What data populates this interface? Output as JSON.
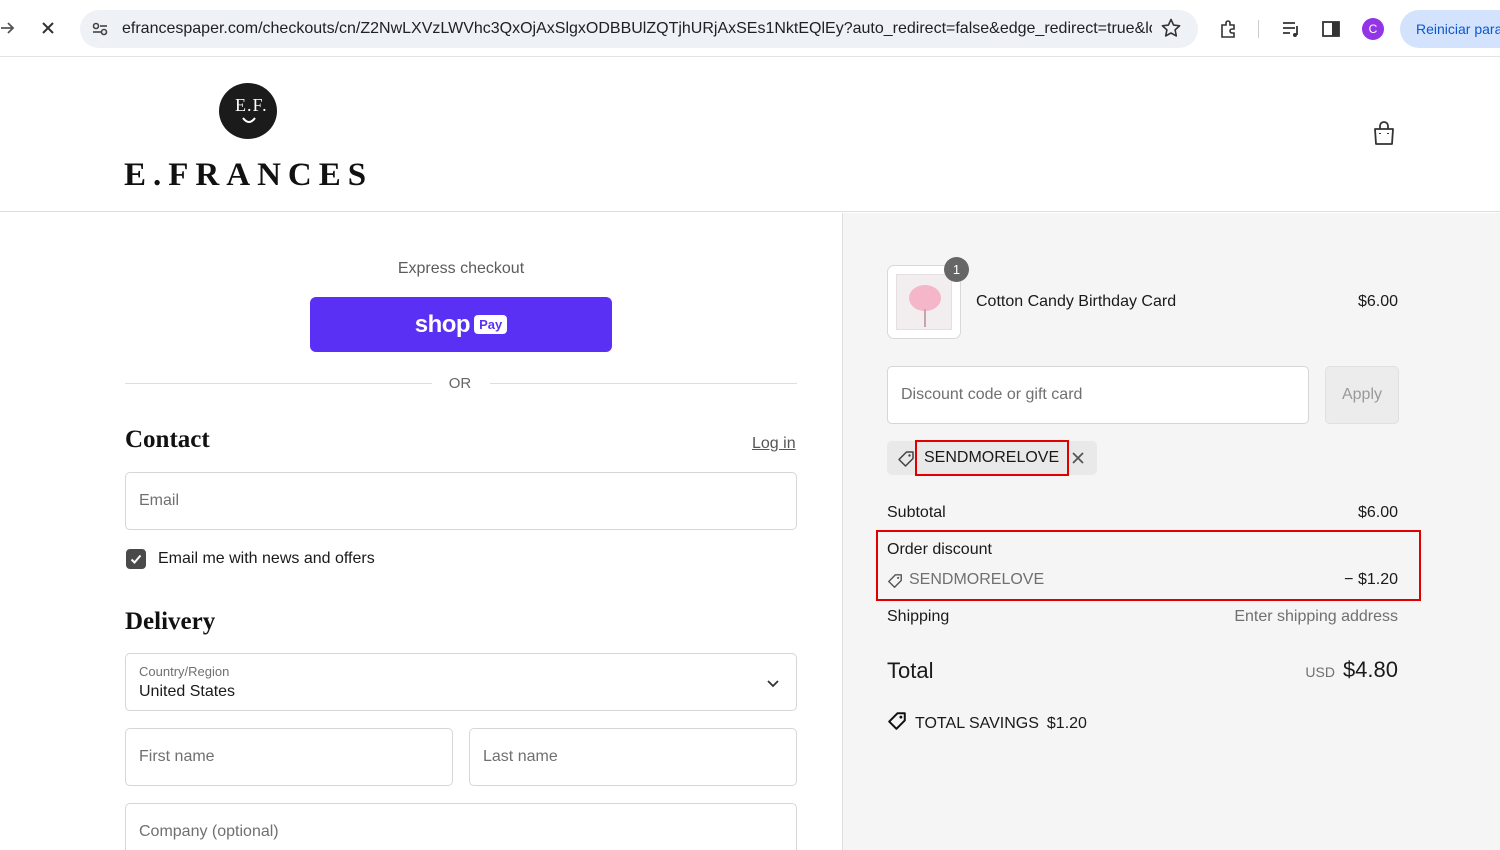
{
  "browser": {
    "url": "efrancespaper.com/checkouts/cn/Z2NwLXVzLWVhc3QxOjAxSlgxODBBUlZQTjhURjAxSEs1NktEQlEy?auto_redirect=false&edge_redirect=true&lo...",
    "profile_initial": "C",
    "reiniciar_label": "Reiniciar para"
  },
  "header": {
    "logo_initials": "E.F.",
    "brand": "E.FRANCES"
  },
  "checkout": {
    "express_label": "Express checkout",
    "shop_pay": {
      "shop": "shop",
      "pay": "Pay"
    },
    "or_label": "OR",
    "contact": {
      "title": "Contact",
      "login_label": "Log in",
      "email_placeholder": "Email",
      "news_checkbox_label": "Email me with news and offers",
      "news_checked": true
    },
    "delivery": {
      "title": "Delivery",
      "country_label": "Country/Region",
      "country_value": "United States",
      "first_name_placeholder": "First name",
      "last_name_placeholder": "Last name",
      "company_placeholder": "Company (optional)"
    }
  },
  "summary": {
    "item": {
      "quantity": "1",
      "name": "Cotton Candy Birthday Card",
      "price": "$6.00"
    },
    "discount_placeholder": "Discount code or gift card",
    "apply_label": "Apply",
    "applied_code": "SENDMORELOVE",
    "subtotal_label": "Subtotal",
    "subtotal_value": "$6.00",
    "order_discount_label": "Order discount",
    "order_discount_code": "SENDMORELOVE",
    "order_discount_value": "− $1.20",
    "shipping_label": "Shipping",
    "shipping_value": "Enter shipping address",
    "total_label": "Total",
    "total_currency": "USD",
    "total_value": "$4.80",
    "savings_label": "TOTAL SAVINGS",
    "savings_value": "$1.20"
  },
  "colors": {
    "shop_pay": "#5a31f4",
    "highlight": "#e00000",
    "summary_bg": "#f5f5f5"
  }
}
